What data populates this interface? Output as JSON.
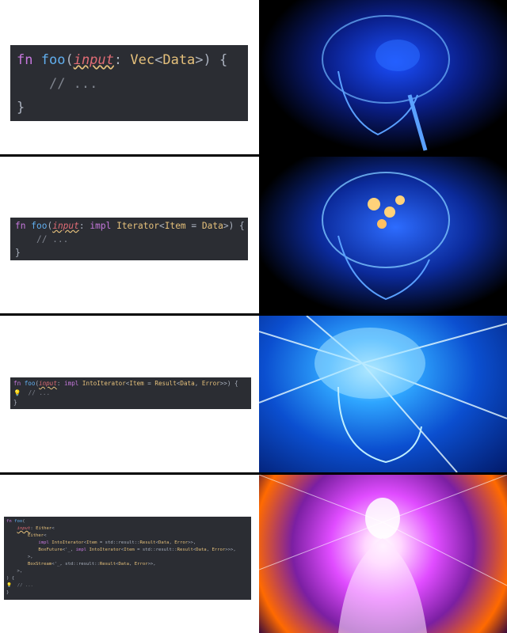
{
  "panels": [
    {
      "lines": [
        [
          [
            "kw",
            "fn"
          ],
          [
            "op",
            " "
          ],
          [
            "fn",
            "foo"
          ],
          [
            "op",
            "("
          ],
          [
            "param",
            "input"
          ],
          [
            "op",
            ": "
          ],
          [
            "ty",
            "Vec"
          ],
          [
            "op",
            "<"
          ],
          [
            "ty",
            "Data"
          ],
          [
            "op",
            ">) {"
          ]
        ],
        [
          [
            "op",
            "    "
          ],
          [
            "cm",
            "// ..."
          ]
        ],
        [
          [
            "op",
            "}"
          ]
        ]
      ],
      "image": "expanding-brain-stage-1"
    },
    {
      "lines": [
        [
          [
            "kw",
            "fn"
          ],
          [
            "op",
            " "
          ],
          [
            "fn",
            "foo"
          ],
          [
            "op",
            "("
          ],
          [
            "param",
            "input"
          ],
          [
            "op",
            ": "
          ],
          [
            "kw",
            "impl"
          ],
          [
            "op",
            " "
          ],
          [
            "ty",
            "Iterator"
          ],
          [
            "op",
            "<"
          ],
          [
            "ty",
            "Item"
          ],
          [
            "op",
            " = "
          ],
          [
            "ty",
            "Data"
          ],
          [
            "op",
            ">) {"
          ]
        ],
        [
          [
            "op",
            "    "
          ],
          [
            "cm",
            "// ..."
          ]
        ],
        [
          [
            "op",
            "}"
          ]
        ]
      ],
      "image": "expanding-brain-stage-2"
    },
    {
      "lines": [
        [
          [
            "kw",
            "fn"
          ],
          [
            "op",
            " "
          ],
          [
            "fn",
            "foo"
          ],
          [
            "op",
            "("
          ],
          [
            "param",
            "input"
          ],
          [
            "op",
            ": "
          ],
          [
            "kw",
            "impl"
          ],
          [
            "op",
            " "
          ],
          [
            "ty",
            "IntoIterator"
          ],
          [
            "op",
            "<"
          ],
          [
            "ty",
            "Item"
          ],
          [
            "op",
            " = "
          ],
          [
            "ty",
            "Result"
          ],
          [
            "op",
            "<"
          ],
          [
            "ty",
            "Data"
          ],
          [
            "op",
            ", "
          ],
          [
            "ty",
            "Error"
          ],
          [
            "op",
            ">>) {"
          ]
        ],
        [
          [
            "bulb",
            "💡"
          ],
          [
            "op",
            "  "
          ],
          [
            "cm",
            "// ..."
          ]
        ],
        [
          [
            "op",
            "}"
          ]
        ]
      ],
      "image": "expanding-brain-stage-3"
    },
    {
      "lines": [
        [
          [
            "kw",
            "fn"
          ],
          [
            "op",
            " "
          ],
          [
            "fn",
            "foo"
          ],
          [
            "op",
            "("
          ]
        ],
        [
          [
            "op",
            "    "
          ],
          [
            "param",
            "input"
          ],
          [
            "op",
            ": "
          ],
          [
            "ty",
            "Either"
          ],
          [
            "op",
            "<"
          ]
        ],
        [
          [
            "op",
            "        "
          ],
          [
            "ty",
            "Either"
          ],
          [
            "op",
            "<"
          ]
        ],
        [
          [
            "op",
            "            "
          ],
          [
            "kw",
            "impl"
          ],
          [
            "op",
            " "
          ],
          [
            "ty",
            "IntoIterator"
          ],
          [
            "op",
            "<"
          ],
          [
            "ty",
            "Item"
          ],
          [
            "op",
            " = std::result::"
          ],
          [
            "ty",
            "Result"
          ],
          [
            "op",
            "<"
          ],
          [
            "ty",
            "Data"
          ],
          [
            "op",
            ", "
          ],
          [
            "ty",
            "Error"
          ],
          [
            "op",
            ">>,"
          ]
        ],
        [
          [
            "op",
            "            "
          ],
          [
            "ty",
            "BoxFuture"
          ],
          [
            "op",
            "<'_, "
          ],
          [
            "kw",
            "impl"
          ],
          [
            "op",
            " "
          ],
          [
            "ty",
            "IntoIterator"
          ],
          [
            "op",
            "<"
          ],
          [
            "ty",
            "Item"
          ],
          [
            "op",
            " = std::result::"
          ],
          [
            "ty",
            "Result"
          ],
          [
            "op",
            "<"
          ],
          [
            "ty",
            "Data"
          ],
          [
            "op",
            ", "
          ],
          [
            "ty",
            "Error"
          ],
          [
            "op",
            ">>>,"
          ]
        ],
        [
          [
            "op",
            "        >,"
          ]
        ],
        [
          [
            "op",
            "        "
          ],
          [
            "ty",
            "BoxStream"
          ],
          [
            "op",
            "<'_, std::result::"
          ],
          [
            "ty",
            "Result"
          ],
          [
            "op",
            "<"
          ],
          [
            "ty",
            "Data"
          ],
          [
            "op",
            ", "
          ],
          [
            "ty",
            "Error"
          ],
          [
            "op",
            ">>,"
          ]
        ],
        [
          [
            "op",
            "    >,"
          ]
        ],
        [
          [
            "op",
            ") {"
          ]
        ],
        [
          [
            "bulb",
            "💡"
          ],
          [
            "op",
            "  "
          ],
          [
            "cm",
            "// ..."
          ]
        ],
        [
          [
            "op",
            "}"
          ]
        ]
      ],
      "image": "expanding-brain-stage-4"
    }
  ]
}
